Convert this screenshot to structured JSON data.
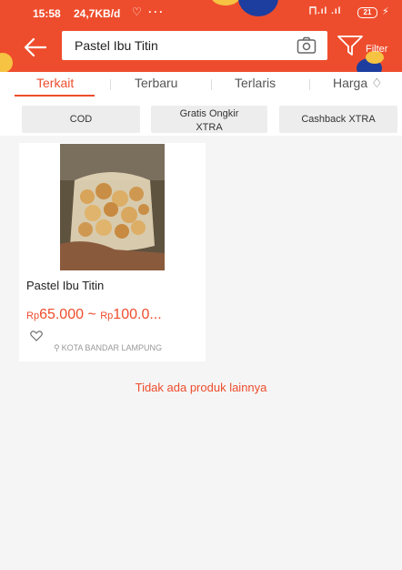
{
  "status_bar": {
    "time": "15:58",
    "speed": "24,7KB/d",
    "extra_icons": "♡ ···",
    "signal": "⨅.ıl .ıl",
    "battery": "21"
  },
  "header": {
    "search_value": "Pastel Ibu Titin",
    "filter_label": "Filter"
  },
  "tabs": [
    {
      "label": "Terkait",
      "active": true
    },
    {
      "label": "Terbaru",
      "active": false
    },
    {
      "label": "Terlaris",
      "active": false
    },
    {
      "label": "Harga ♢",
      "active": false
    }
  ],
  "chips": [
    {
      "label": "COD"
    },
    {
      "label_line1": "Gratis Ongkir",
      "label_line2": "XTRA"
    },
    {
      "label": "Cashback XTRA"
    }
  ],
  "product": {
    "name": "Pastel Ibu Titin",
    "price_rp1": "Rp",
    "price_val1": "65.000",
    "price_sep": " ~ ",
    "price_rp2": "Rp",
    "price_val2": "100.0...",
    "location": "KOTA BANDAR LAMPUNG"
  },
  "footer_message": "Tidak ada produk lainnya",
  "colors": {
    "brand": "#ee4d2d",
    "background": "#f5f5f5"
  }
}
